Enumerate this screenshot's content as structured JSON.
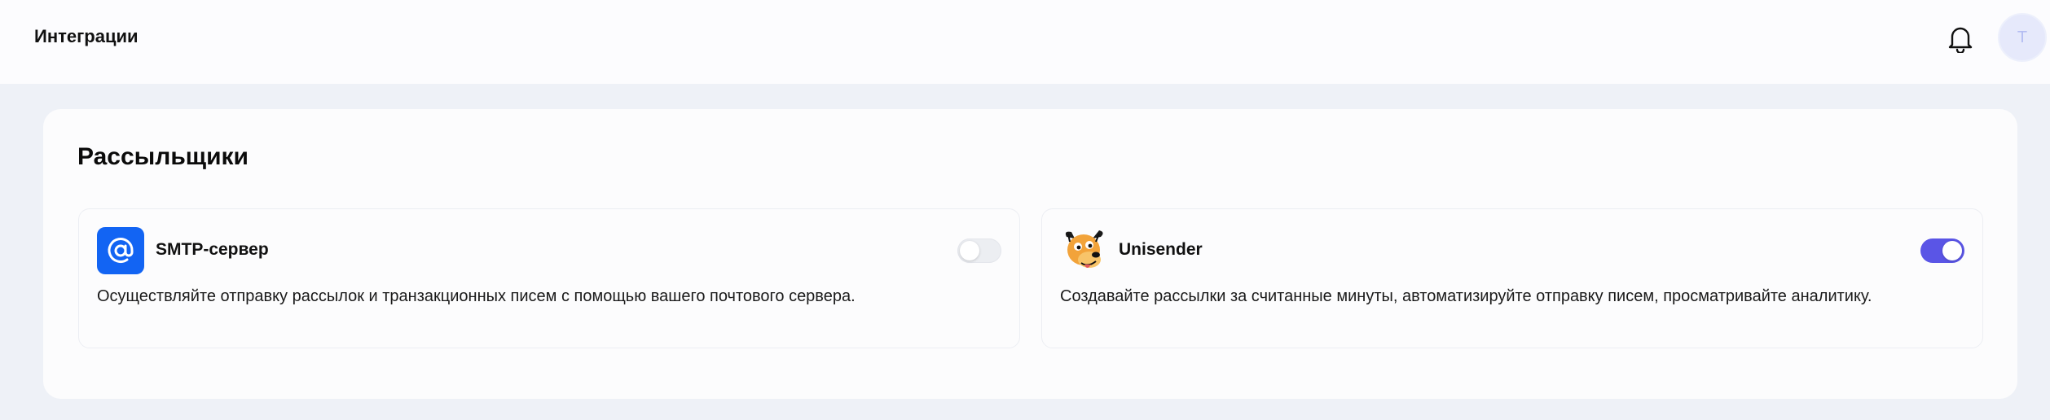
{
  "header": {
    "title": "Интеграции",
    "notifications_icon": "bell-icon",
    "avatar_initial": "T"
  },
  "section": {
    "title": "Рассыльщики"
  },
  "integrations": [
    {
      "name": "SMTP-сервер",
      "icon": "at-sign-icon",
      "description": "Осуществляйте отправку рассылок и транзакционных писем с помощью вашего почтового сервера.",
      "enabled": false
    },
    {
      "name": "Unisender",
      "icon": "unisender-dog-logo",
      "description": "Создавайте рассылки за считанные минуты, автоматизируйте отправку писем, просматривайте аналитику.",
      "enabled": true
    }
  ],
  "colors": {
    "accent": "#5a55e6",
    "smtp_brand": "#1264f3",
    "page_bg": "#eef1f7"
  }
}
